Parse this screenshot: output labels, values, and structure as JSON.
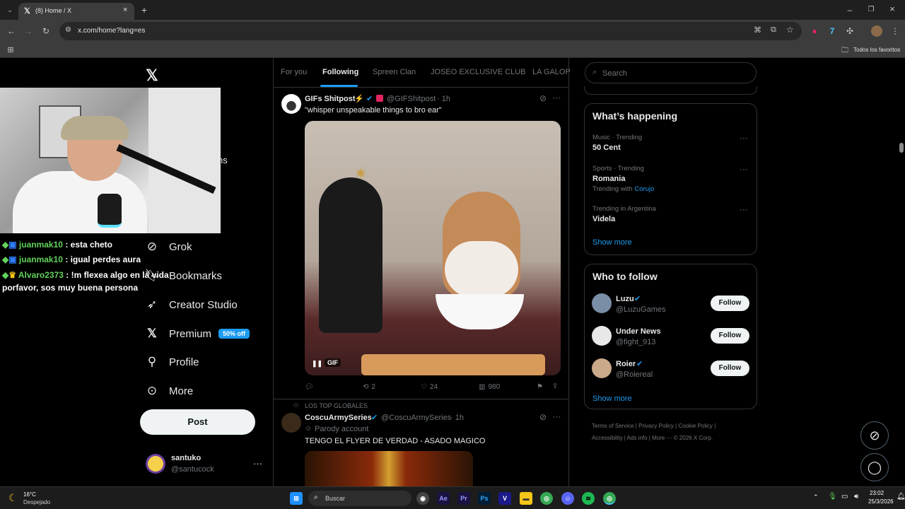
{
  "browser": {
    "tab_title": "(8) Home / X",
    "url": "x.com/home?lang=es",
    "bookmarks_all": "Todos los favoritos"
  },
  "sidebar": {
    "partial_text": "ns",
    "items": [
      {
        "label": "Grok",
        "icon": "grok-icon"
      },
      {
        "label": "Bookmarks",
        "icon": "bookmark-icon"
      },
      {
        "label": "Creator Studio",
        "icon": "rocket-icon"
      },
      {
        "label": "Premium",
        "icon": "x-logo-icon",
        "badge": "50% off"
      },
      {
        "label": "Profile",
        "icon": "person-icon"
      },
      {
        "label": "More",
        "icon": "more-circle-icon"
      }
    ],
    "post_label": "Post",
    "account": {
      "name": "santuko",
      "handle": "@santucock"
    }
  },
  "chat": [
    {
      "user": "juanmak10",
      "text": ": esta cheto"
    },
    {
      "user": "juanmak10",
      "text": ": igual perdes aura"
    },
    {
      "user": "Alvaro2373",
      "text": ": !m flexea algo en la vida",
      "cont": "porfavor, sos muy buena persona"
    }
  ],
  "feed": {
    "tabs": [
      "For you",
      "Following",
      "Spreen Clan",
      "JOSEO EXCLUSIVE CLUB",
      "LA GALOP"
    ],
    "active_tab": "Following",
    "tweets": [
      {
        "name": "GIFs Shitpost",
        "handle": "@GIFShitpost",
        "time": "· 1h",
        "text": "\"whisper unspeakable things to bro ear\"",
        "media_label": "GIF",
        "reposts": "2",
        "likes": "24",
        "views": "980"
      },
      {
        "social_context": "LOS TOP GLOBALES",
        "name": "CoscuArmySeries",
        "handle": "@CoscuArmySeries",
        "time": "· 1h",
        "label": "Parody account",
        "text": "TENGO EL FLYER DE VERDAD - ASADO MAGICO"
      }
    ]
  },
  "right": {
    "search_placeholder": "Search",
    "happening_title": "What’s happening",
    "trends": [
      {
        "meta": "Music · Trending",
        "name": "50 Cent"
      },
      {
        "meta": "Sports · Trending",
        "name": "Romania",
        "extra_prefix": "Trending with",
        "extra_link": "Corujo"
      },
      {
        "meta": "Trending in Argentina",
        "name": "Videla"
      }
    ],
    "show_more": "Show more",
    "who_title": "Who to follow",
    "follow_label": "Follow",
    "suggestions": [
      {
        "name": "Luzu",
        "handle": "@LuzuGames",
        "verified": true
      },
      {
        "name": "Under News",
        "handle": "@fight_913",
        "verified": false
      },
      {
        "name": "Roier",
        "handle": "@Roiereal",
        "verified": true
      }
    ],
    "footer": {
      "links": [
        "Terms of Service",
        "Privacy Policy",
        "Cookie Policy",
        "Accessibility",
        "Ads info",
        "More ···"
      ],
      "copyright": "© 2026 X Corp."
    }
  },
  "taskbar": {
    "weather_temp": "16°C",
    "weather_desc": "Despejado",
    "search_label": "Buscar",
    "time": "23:02",
    "date": "25/3/2026"
  },
  "colors": {
    "accent": "#1d9bf0",
    "chat_user": "#62d15b",
    "background": "#000000"
  }
}
